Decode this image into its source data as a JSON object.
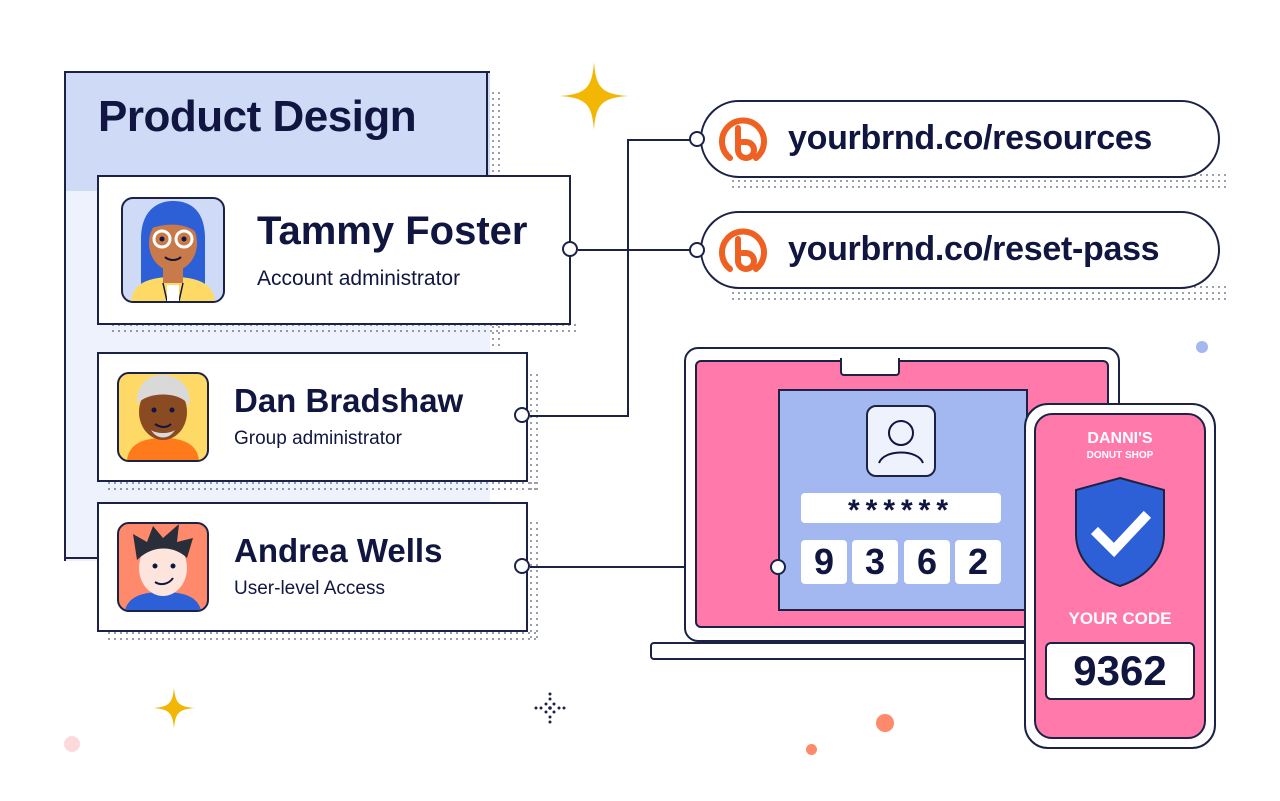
{
  "group": {
    "title": "Product Design"
  },
  "members": [
    {
      "name": "Tammy Foster",
      "role": "Account administrator",
      "avatar": "woman-blue-hair-glasses-avatar"
    },
    {
      "name": "Dan Bradshaw",
      "role": "Group administrator",
      "avatar": "older-man-gray-hair-avatar"
    },
    {
      "name": "Andrea Wells",
      "role": "User-level Access",
      "avatar": "young-man-spiky-hair-avatar"
    }
  ],
  "links": [
    {
      "url": "yourbrnd.co/resources",
      "icon": "bitly-logo-icon"
    },
    {
      "url": "yourbrnd.co/reset-pass",
      "icon": "bitly-logo-icon"
    }
  ],
  "laptop": {
    "password_mask": "******",
    "code_digits": [
      "9",
      "3",
      "6",
      "2"
    ]
  },
  "phone": {
    "brand_line1": "DANNI'S",
    "brand_line2": "DONUT SHOP",
    "code_label": "YOUR CODE",
    "code_value": "9362"
  },
  "colors": {
    "navy": "#101640",
    "pink": "#ff7aab",
    "lavender": "#a3b8f0",
    "panel_blue": "#cfdaf7",
    "bitly_orange": "#ee6123",
    "shield_blue": "#2d5fd6",
    "star_gold": "#f2b705"
  }
}
